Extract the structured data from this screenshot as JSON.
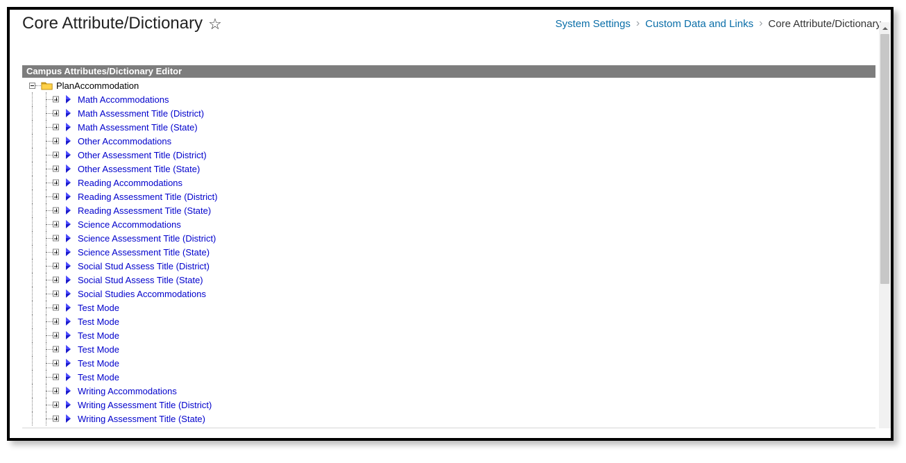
{
  "header": {
    "title": "Core Attribute/Dictionary",
    "breadcrumb": {
      "item1": "System Settings",
      "item2": "Custom Data and Links",
      "current": "Core Attribute/Dictionary"
    }
  },
  "panel": {
    "title": "Campus Attributes/Dictionary Editor"
  },
  "tree": {
    "root_label": "PlanAccommodation",
    "children": [
      {
        "label": "Math Accommodations"
      },
      {
        "label": "Math Assessment Title (District)"
      },
      {
        "label": "Math Assessment Title (State)"
      },
      {
        "label": "Other Accommodations"
      },
      {
        "label": "Other Assessment Title (District)"
      },
      {
        "label": "Other Assessment Title (State)"
      },
      {
        "label": "Reading Accommodations"
      },
      {
        "label": "Reading Assessment Title (District)"
      },
      {
        "label": "Reading Assessment Title (State)"
      },
      {
        "label": "Science Accommodations"
      },
      {
        "label": "Science Assessment Title (District)"
      },
      {
        "label": "Science Assessment Title (State)"
      },
      {
        "label": "Social Stud Assess Title (District)"
      },
      {
        "label": "Social Stud Assess Title (State)"
      },
      {
        "label": "Social Studies Accommodations"
      },
      {
        "label": "Test Mode"
      },
      {
        "label": "Test Mode"
      },
      {
        "label": "Test Mode"
      },
      {
        "label": "Test Mode"
      },
      {
        "label": "Test Mode"
      },
      {
        "label": "Test Mode"
      },
      {
        "label": "Writing Accommodations"
      },
      {
        "label": "Writing Assessment Title (District)"
      },
      {
        "label": "Writing Assessment Title (State)"
      }
    ]
  }
}
